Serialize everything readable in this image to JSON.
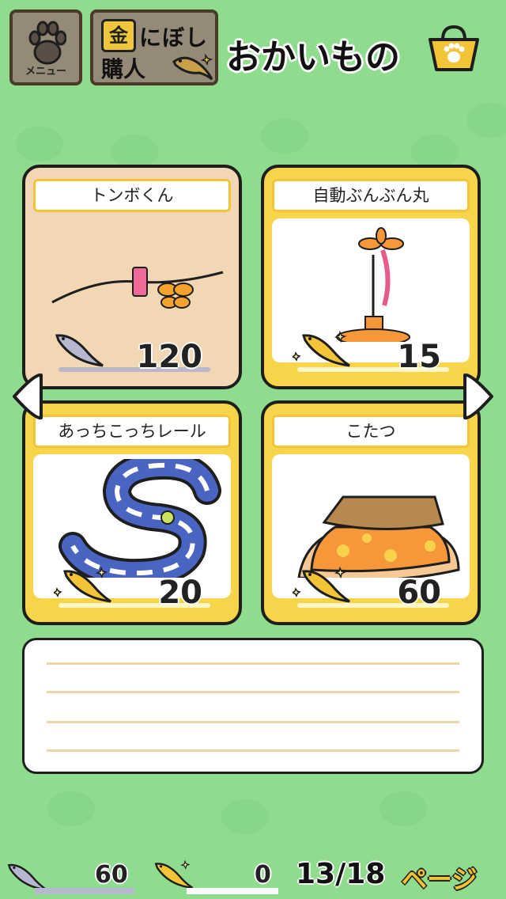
{
  "header": {
    "menu_label": "メニュー",
    "gold_kanji": "金",
    "gold_line1": "にぼし",
    "gold_line2": "購人",
    "title": "おかいもの",
    "icons": [
      "paw-icon",
      "gold-fish-icon",
      "shopping-bag-icon"
    ]
  },
  "items": [
    {
      "name": "トンボくん",
      "price": "120",
      "currency": "silver",
      "selected": true
    },
    {
      "name": "自動ぶんぶん丸",
      "price": "15",
      "currency": "gold",
      "selected": false
    },
    {
      "name": "あっちこっちレール",
      "price": "20",
      "currency": "gold",
      "selected": false
    },
    {
      "name": "こたつ",
      "price": "60",
      "currency": "gold",
      "selected": false
    }
  ],
  "description": {
    "text": ""
  },
  "footer": {
    "silver_count": "60",
    "gold_count": "0",
    "page": "13/18",
    "page_label": "ページ"
  },
  "colors": {
    "background": "#8fdc8f",
    "gold": "#f6d54a",
    "selected": "#f1d7b4"
  }
}
